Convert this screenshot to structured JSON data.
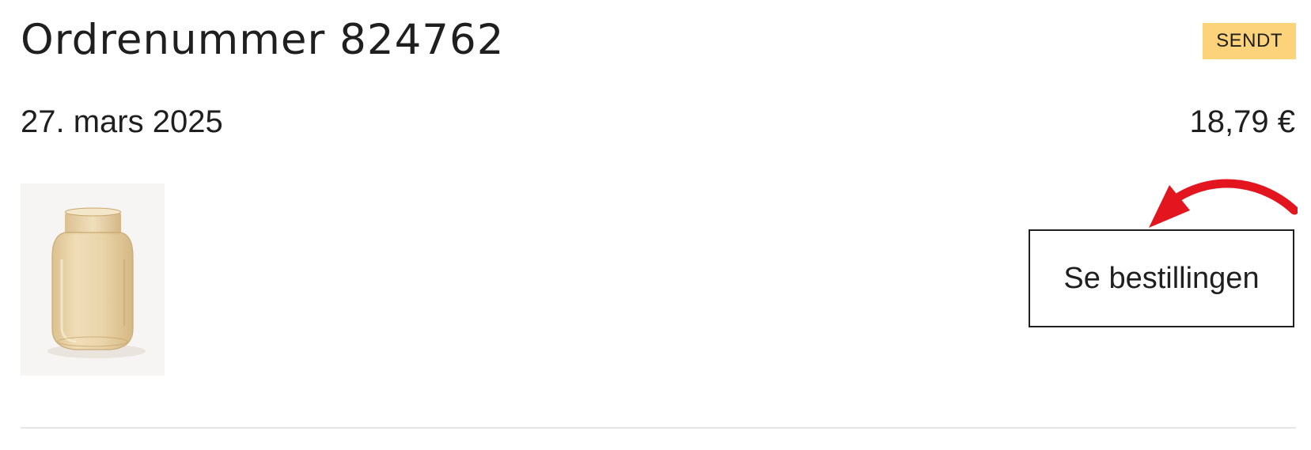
{
  "order": {
    "title": "Ordrenummer 824762",
    "status": "SENDT",
    "date": "27. mars 2025",
    "total": "18,79 €",
    "view_button_label": "Se bestillingen",
    "product_image_icon": "glass-vase-image"
  },
  "colors": {
    "status_badge": "#fcd27a",
    "annotation_arrow": "#e3151f",
    "text": "#1f1f1f"
  },
  "annotation": {
    "icon": "red-curved-arrow-icon"
  }
}
